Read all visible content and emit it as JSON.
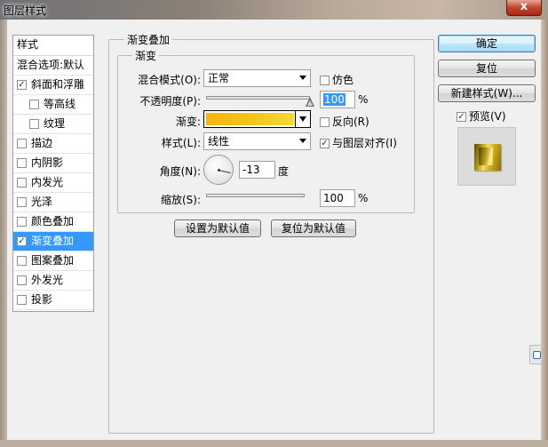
{
  "window": {
    "title": "图层样式",
    "close_label": "x"
  },
  "style_list": {
    "header": "样式",
    "blending_options": "混合选项:默认",
    "items": [
      {
        "label": "斜面和浮雕",
        "checked": true,
        "sub": false,
        "selected": false
      },
      {
        "label": "等高线",
        "checked": false,
        "sub": true,
        "selected": false
      },
      {
        "label": "纹理",
        "checked": false,
        "sub": true,
        "selected": false
      },
      {
        "label": "描边",
        "checked": false,
        "sub": false,
        "selected": false
      },
      {
        "label": "内阴影",
        "checked": false,
        "sub": false,
        "selected": false
      },
      {
        "label": "内发光",
        "checked": false,
        "sub": false,
        "selected": false
      },
      {
        "label": "光泽",
        "checked": false,
        "sub": false,
        "selected": false
      },
      {
        "label": "颜色叠加",
        "checked": false,
        "sub": false,
        "selected": false
      },
      {
        "label": "渐变叠加",
        "checked": true,
        "sub": false,
        "selected": true
      },
      {
        "label": "图案叠加",
        "checked": false,
        "sub": false,
        "selected": false
      },
      {
        "label": "外发光",
        "checked": false,
        "sub": false,
        "selected": false
      },
      {
        "label": "投影",
        "checked": false,
        "sub": false,
        "selected": false
      }
    ]
  },
  "panel": {
    "section_title": "渐变叠加",
    "group_title": "渐变",
    "blend_mode": {
      "label": "混合模式(O):",
      "value": "正常"
    },
    "dither": {
      "label": "仿色",
      "checked": false
    },
    "opacity": {
      "label": "不透明度(P):",
      "value": "100",
      "unit": "%",
      "level": 100
    },
    "gradient": {
      "label": "渐变:",
      "colors": [
        "#f7b510",
        "#f6c21a",
        "#f3da36"
      ]
    },
    "reverse": {
      "label": "反向(R)",
      "checked": false
    },
    "style": {
      "label": "样式(L):",
      "value": "线性"
    },
    "align": {
      "label": "与图层对齐(I)",
      "checked": true
    },
    "angle": {
      "label": "角度(N):",
      "value": "-13",
      "unit": "度",
      "degrees": -13
    },
    "scale": {
      "label": "缩放(S):",
      "value": "100",
      "unit": "%",
      "level": 100
    },
    "make_default": "设置为默认值",
    "reset_default": "复位为默认值"
  },
  "actions": {
    "ok": "确定",
    "reset": "复位",
    "new_style": "新建样式(W)...",
    "preview": {
      "label": "预览(V)",
      "checked": true
    }
  }
}
